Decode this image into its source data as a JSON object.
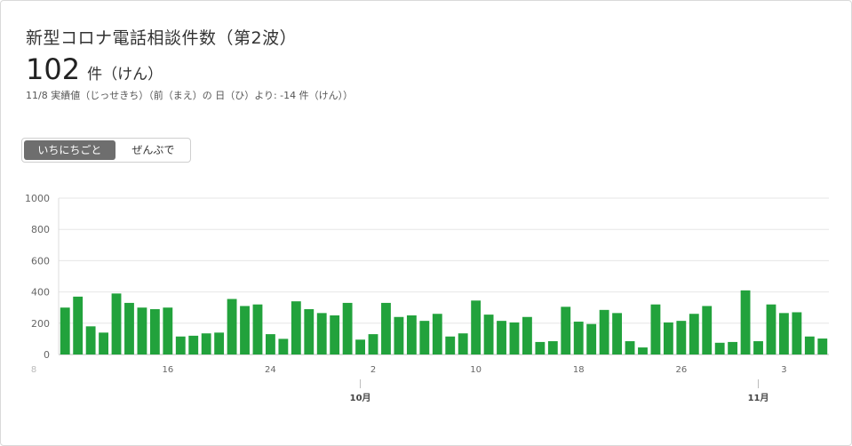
{
  "card": {
    "title": "新型コロナ電話相談件数（第2波）",
    "value": "102",
    "unit": "件（けん）",
    "subtitle": "11/8 実績値（じっせきち）（前（まえ）の 日（ひ）より: -14 件（けん））"
  },
  "toggle": {
    "options": [
      "いちにちごと",
      "ぜんぶで"
    ],
    "selected": "いちにちごと"
  },
  "colors": {
    "bar": "#22a23c",
    "grid": "#e6e6e6"
  },
  "chart_data": {
    "type": "bar",
    "ylim": [
      0,
      1000
    ],
    "yticks": [
      0,
      200,
      400,
      600,
      800,
      1000
    ],
    "xtick_labels": [
      {
        "label": "8",
        "index": 0,
        "faint": true
      },
      {
        "label": "16",
        "index": 8
      },
      {
        "label": "24",
        "index": 16
      },
      {
        "label": "2",
        "index": 24
      },
      {
        "label": "10",
        "index": 32
      },
      {
        "label": "18",
        "index": 40
      },
      {
        "label": "26",
        "index": 48
      },
      {
        "label": "3",
        "index": 56
      }
    ],
    "month_labels": [
      {
        "label": "10月",
        "index": 23
      },
      {
        "label": "11月",
        "index": 54
      }
    ],
    "values": [
      300,
      370,
      180,
      140,
      390,
      330,
      300,
      290,
      300,
      115,
      120,
      135,
      140,
      355,
      310,
      320,
      130,
      100,
      340,
      290,
      265,
      250,
      330,
      95,
      130,
      330,
      240,
      250,
      215,
      260,
      115,
      135,
      345,
      255,
      215,
      205,
      240,
      80,
      85,
      305,
      210,
      195,
      285,
      265,
      85,
      45,
      320,
      205,
      215,
      260,
      310,
      75,
      80,
      410,
      85,
      320,
      265,
      270,
      115,
      102
    ]
  }
}
